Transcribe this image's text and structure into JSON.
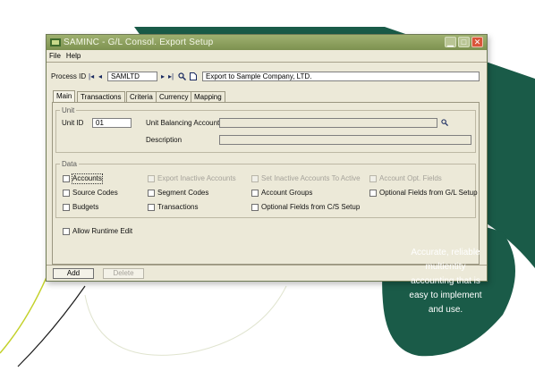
{
  "window": {
    "title": "SAMINC - G/L Consol. Export Setup",
    "menu": [
      "File",
      "Help"
    ]
  },
  "process": {
    "label": "Process ID",
    "id_value": "SAMLTD",
    "description": "Export to Sample Company, LTD."
  },
  "tabs": [
    "Main",
    "Transactions",
    "Criteria",
    "Currency",
    "Mapping"
  ],
  "unit": {
    "group_label": "Unit",
    "id_label": "Unit ID",
    "id_value": "01",
    "balancing_label": "Unit Balancing Account",
    "balancing_value": "",
    "description_label": "Description",
    "description_value": ""
  },
  "data_group": {
    "label": "Data",
    "row1": [
      "Accounts",
      "Export Inactive Accounts",
      "Set Inactive Accounts To Active",
      "Account Opt. Fields"
    ],
    "row2": [
      "Source Codes",
      "Segment Codes",
      "Account Groups",
      "Optional Fields from G/L Setup"
    ],
    "row3": [
      "Budgets",
      "Transactions",
      "Optional Fields from C/S Setup"
    ]
  },
  "runtime_label": "Allow Runtime Edit",
  "buttons": {
    "add": "Add",
    "delete": "Delete"
  },
  "promo": {
    "line1": "Accurate, reliable",
    "line2": "multientity",
    "line3": "accounting that is",
    "line4": "easy to implement",
    "line5": "and use."
  },
  "icons": [
    "app-icon",
    "minimize-icon",
    "maximize-icon",
    "close-icon",
    "first-record-icon",
    "previous-record-icon",
    "next-record-icon",
    "last-record-icon",
    "finder-icon",
    "new-document-icon"
  ],
  "colors": {
    "background_teal": "#1a5b48",
    "window_face": "#ece9d8",
    "titlebar": "#8a9c5c",
    "lime_accent": "#c3d12a",
    "close_button": "#d9553a"
  }
}
